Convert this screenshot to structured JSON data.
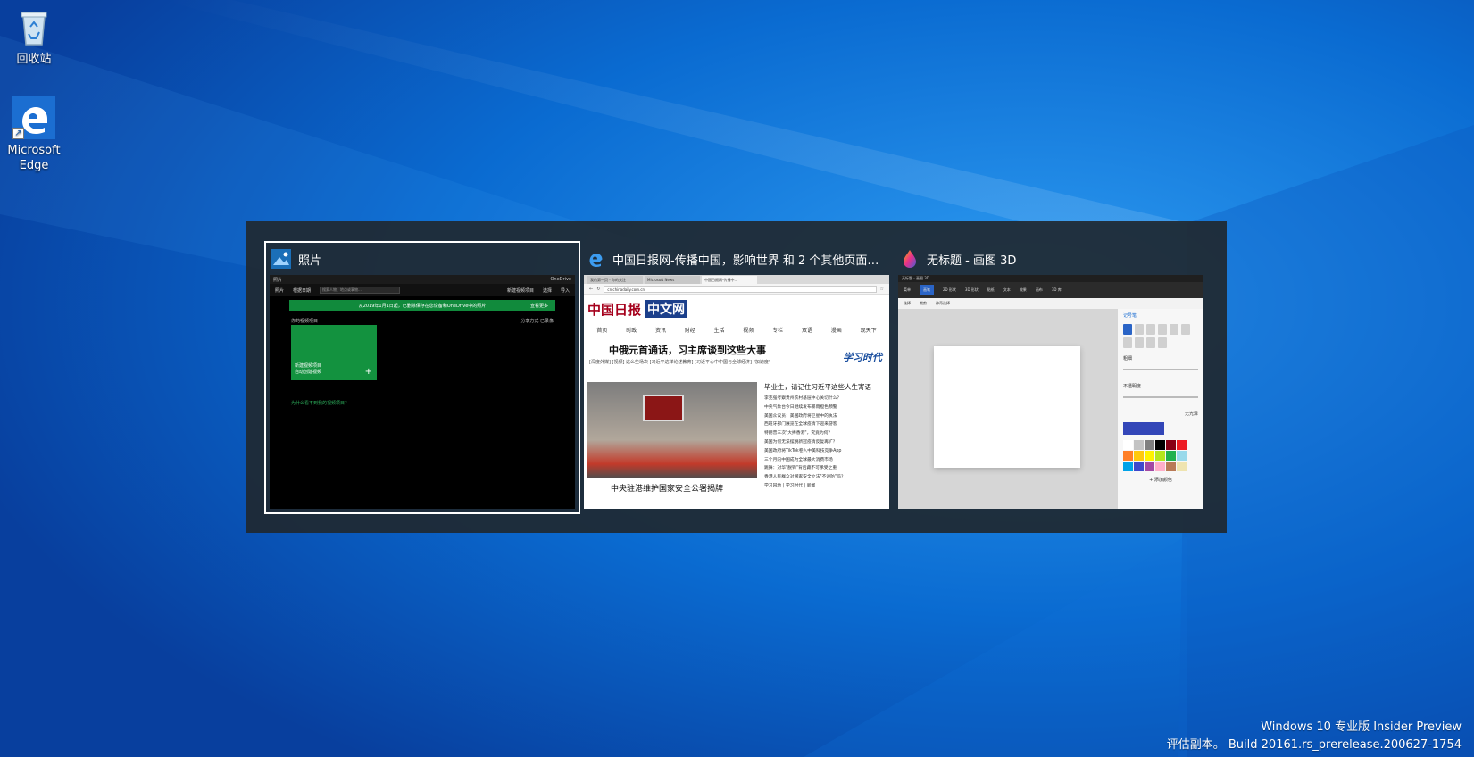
{
  "desktop": {
    "icons": [
      {
        "label": "回收站",
        "icon": "recycle-bin-icon"
      },
      {
        "label": "Microsoft Edge",
        "icon": "edge-icon"
      }
    ]
  },
  "switcher": {
    "windows": [
      {
        "title": "照片",
        "icon": "photos-app-icon",
        "selected": true,
        "content": {
          "titlebar": "照片",
          "titlebar_right": "OneDrive",
          "toolbar_items": [
            "照片",
            "根据日期",
            "新建视频项目",
            "选择",
            "导入"
          ],
          "search_placeholder": "搜索人物、地点或事物...",
          "banner": "从2019年1月1日起，已删除保存在您设备和OneDrive中的照片",
          "banner_action": "查看更多",
          "section": "你的视频项目",
          "section_right": "分享方式  已录像",
          "card_title": "新建视频项目",
          "card_subtitle": "自动创建视频",
          "link": "为什么看不到我的视频项目?"
        }
      },
      {
        "title": "中国日报网-传播中国，影响世界 和 2 个其他页面 -...",
        "icon": "edge-app-icon",
        "selected": false,
        "content": {
          "tabs": [
            "我的第一页 - 你的关注",
            "Microsoft News",
            "中国日报网-传播中..."
          ],
          "address": "cn.chinadaily.com.cn",
          "logo": "中国日报",
          "logo_sub": "中文网",
          "nav": [
            "首页",
            "时政",
            "资讯",
            "财经",
            "生活",
            "视频",
            "专栏",
            "双语",
            "漫画",
            "观天下"
          ],
          "headline": "中俄元首通话，习主席谈到这些大事",
          "subline": "[深度外媒]  [视频]  这么些场次  [习近平这样论述教育]  [习近平心中中国与全球经济]  \"加速度\"",
          "badge": "学习时代",
          "list_lead": "毕业生，请记住习近平这些人生寄语",
          "list": [
            "李克强考察贵州农村基层中心关切什么？",
            "中央气象台今日继续发布暴雨橙色预警",
            "美国众议员：美国政府将卫星中的执法",
            "西班牙部门展览在全球疫情下迎来游客",
            "特朗普三次\"大捧香港\"，究竟为何？",
            "美国为何无法摆脱新冠疫情反复再扩？",
            "美国政府将TikTok卷入中美科技竞争App",
            "三个月内中国成为全球最大消费市场",
            "跳舞：对华\"脱钩\"背后藏不可承受之重",
            "香港人民群众对国家安全立法\"不设防\"吗？",
            "学习园地 | 学习时代 | 新闻"
          ],
          "caption": "中央驻港维护国家安全公署揭牌"
        }
      },
      {
        "title": "无标题 - 画图 3D",
        "icon": "paint3d-app-icon",
        "selected": false,
        "content": {
          "titlebar": "无标题 - 画图 3D",
          "ribbon": [
            "菜单",
            "画笔",
            "2D 形状",
            "3D 形状",
            "贴纸",
            "文本",
            "效果",
            "画布",
            "3D 库"
          ],
          "sub": [
            "选择",
            "裁剪",
            "神奇选择"
          ],
          "panel_title": "记号笔",
          "thickness_label": "粗细",
          "opacity_label": "不透明度",
          "finish_label": "无光泽",
          "add_color": "添加颜色",
          "swatches": [
            "#ffffff",
            "#c3c3c3",
            "#7f7f7f",
            "#000000",
            "#880015",
            "#ed1c24",
            "#ff7f27",
            "#ffc90e",
            "#fff200",
            "#b5e61d",
            "#22b14c",
            "#99d9ea",
            "#00a2e8",
            "#3f48cc",
            "#a349a4",
            "#ffaec9",
            "#b97a57",
            "#efe4b0"
          ]
        }
      }
    ]
  },
  "watermark": {
    "line1": "Windows 10 专业版 Insider Preview",
    "line2": "评估副本。 Build 20161.rs_prerelease.200627-1754"
  }
}
